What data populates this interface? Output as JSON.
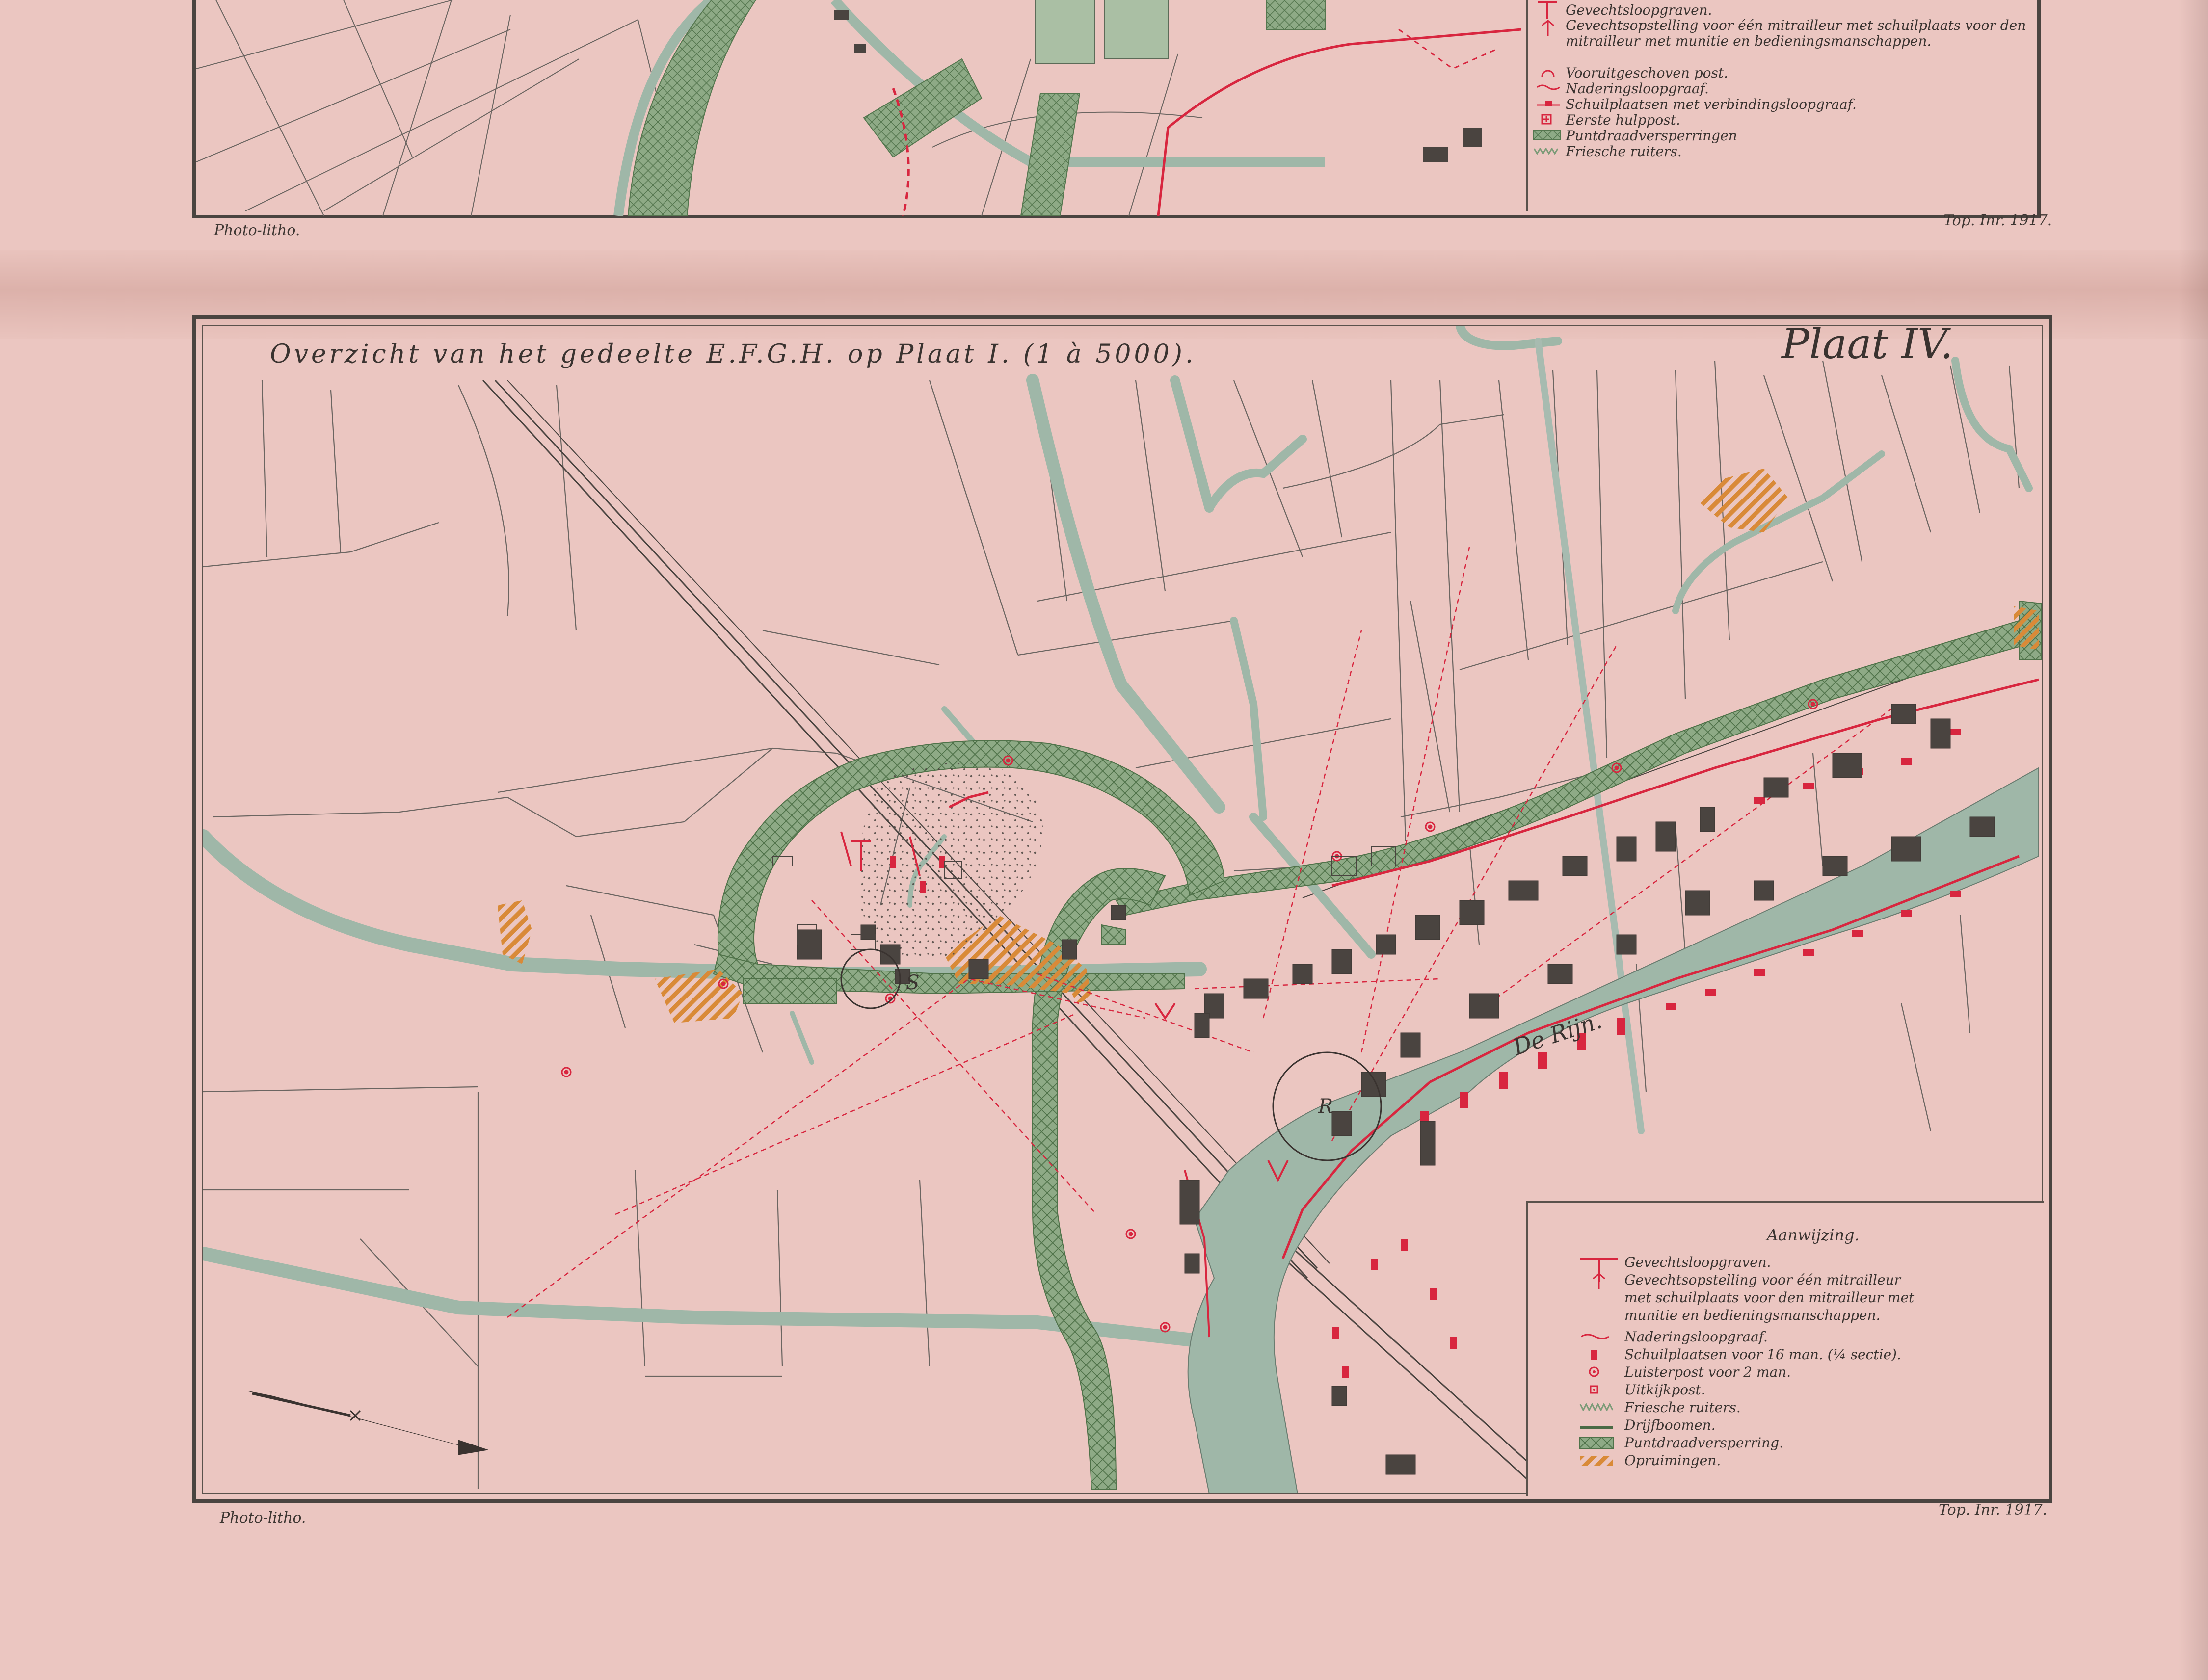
{
  "colors": {
    "paper": "#ebc6c1",
    "water": "#9fb7a8",
    "barbed_wire": "#7c9b78",
    "trench_red": "#d8263f",
    "clearing_orange": "#d98a38",
    "ink": "#3a3330"
  },
  "top_map": {
    "legend": [
      {
        "icon": "trench-line-icon",
        "text": "Gevechtsloopgraven."
      },
      {
        "icon": "machine-gun-emplacement-icon",
        "text": "Gevechtsopstelling voor één mitrailleur met schuilplaats voor den mitrailleur met munitie en bedieningsmanschappen."
      },
      {
        "icon": "advanced-post-icon",
        "text": "Vooruitgeschoven post."
      },
      {
        "icon": "approach-trench-icon",
        "text": "Naderingsloopgraaf."
      },
      {
        "icon": "shelter-icon",
        "text": "Schuilplaatsen met verbindingsloopgraaf."
      },
      {
        "icon": "first-aid-post-icon",
        "text": "Eerste hulppost."
      },
      {
        "icon": "barbed-wire-icon",
        "text": "Puntdraadversperringen"
      },
      {
        "icon": "friesche-ruiters-icon",
        "text": "Friesche ruiters."
      }
    ],
    "footer_left": "Photo-litho.",
    "footer_right": "Top. Inr. 1917."
  },
  "bottom_map": {
    "title": "Overzicht van het gedeelte E.F.G.H. op Plaat I. (1 à 5000).",
    "plate": "Plaat IV.",
    "labels": {
      "river": "De Rijn.",
      "r_marker": "R",
      "s_marker": "S"
    },
    "legend_title": "Aanwijzing.",
    "legend": [
      {
        "icon": "trench-line-icon",
        "text": "Gevechtsloopgraven."
      },
      {
        "icon": "machine-gun-emplacement-icon",
        "text": "Gevechtsopstelling voor één mitrailleur"
      },
      {
        "icon": "",
        "text": "met schuilplaats voor den mitrailleur met"
      },
      {
        "icon": "",
        "text": "munitie en bedieningsmanschappen."
      },
      {
        "icon": "approach-trench-icon",
        "text": "Naderingsloopgraaf."
      },
      {
        "icon": "shelter-icon",
        "text": "Schuilplaatsen voor 16 man. (¼ sectie)."
      },
      {
        "icon": "listening-post-icon",
        "text": "Luisterpost voor 2 man."
      },
      {
        "icon": "lookout-post-icon",
        "text": "Uitkijkpost."
      },
      {
        "icon": "friesche-ruiters-icon",
        "text": "Friesche ruiters."
      },
      {
        "icon": "floating-boom-icon",
        "text": "Drijfboomen."
      },
      {
        "icon": "barbed-wire-icon",
        "text": "Puntdraadversperring."
      },
      {
        "icon": "clearing-icon",
        "text": "Opruimingen."
      }
    ],
    "footer_left": "Photo-litho.",
    "footer_right": "Top. Inr. 1917."
  }
}
